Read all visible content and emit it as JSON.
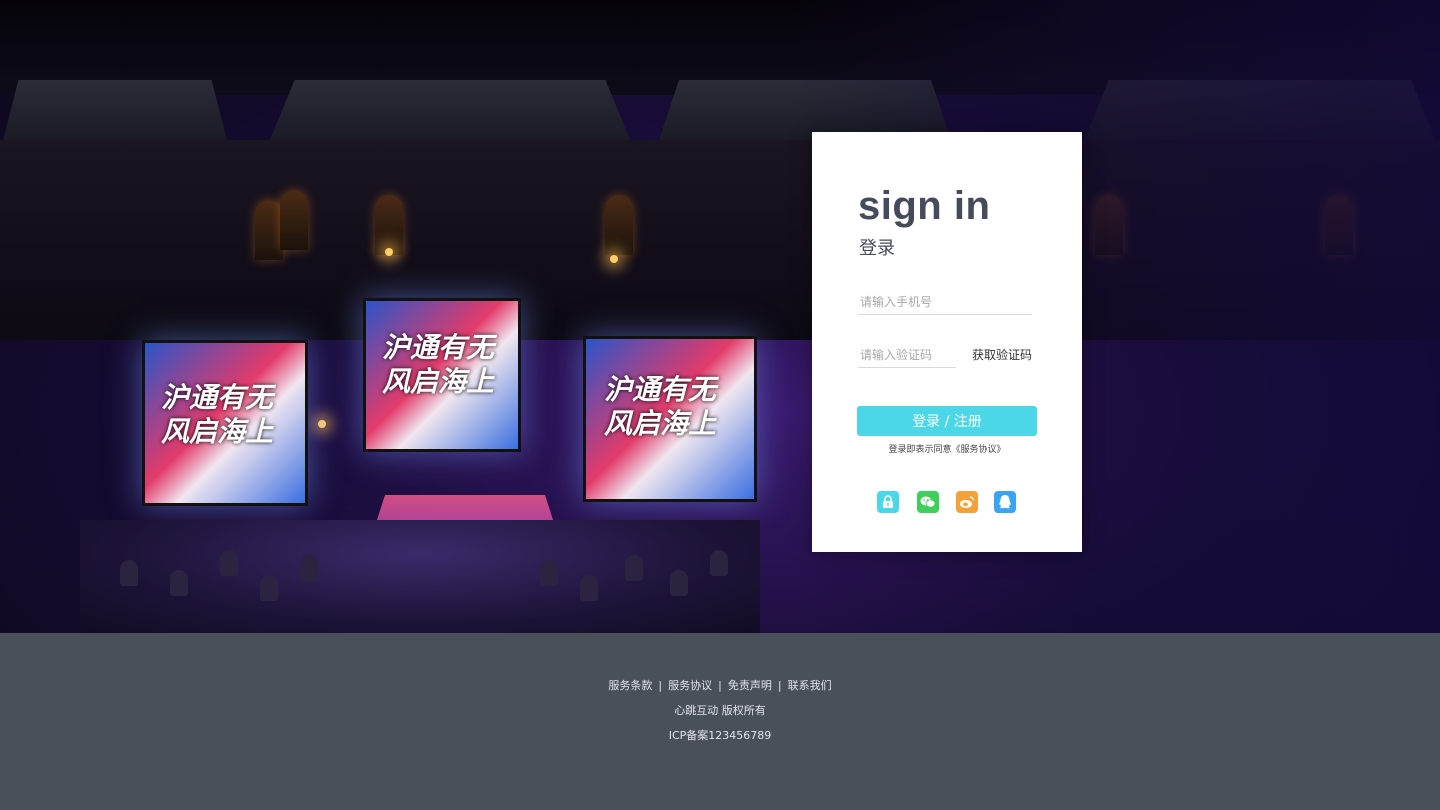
{
  "login": {
    "title": "sign in",
    "subtitle": "登录",
    "phone_placeholder": "请输入手机号",
    "code_placeholder": "请输入验证码",
    "get_code_label": "获取验证码",
    "submit_label": "登录  /  注册",
    "agreement_text": "登录即表示同意《服务协议》",
    "socials": [
      {
        "name": "lock-icon",
        "color": "#4bd7e8"
      },
      {
        "name": "wechat-icon",
        "color": "#3fcf5c"
      },
      {
        "name": "weibo-icon",
        "color": "#f5a13a"
      },
      {
        "name": "qq-icon",
        "color": "#3aa4f0"
      }
    ]
  },
  "background": {
    "screen_text_left": "沪通有无\n风启海上",
    "screen_text_center": "沪通有无\n风启海上",
    "screen_text_right": "沪通有无\n风启海上"
  },
  "footer": {
    "links": [
      "服务条款",
      "服务协议",
      "免责声明",
      "联系我们"
    ],
    "copyright": "心跳互动 版权所有",
    "icp": "ICP备案123456789"
  },
  "colors": {
    "accent": "#4bd7e8",
    "footer_bg": "#4a505a",
    "title": "#454b5a"
  }
}
